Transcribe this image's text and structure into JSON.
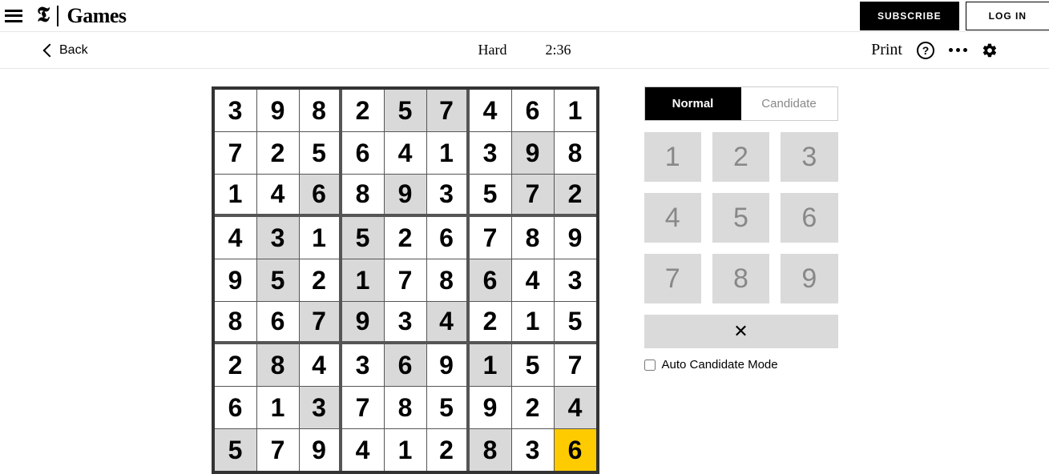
{
  "header": {
    "brand_t": "𝕿",
    "brand_text": "Games",
    "subscribe_label": "SUBSCRIBE",
    "login_label": "LOG IN"
  },
  "toolbar": {
    "back_label": "Back",
    "difficulty": "Hard",
    "timer": "2:36",
    "print_label": "Print"
  },
  "modes": {
    "normal": "Normal",
    "candidate": "Candidate"
  },
  "numpad": [
    "1",
    "2",
    "3",
    "4",
    "5",
    "6",
    "7",
    "8",
    "9"
  ],
  "erase_glyph": "✕",
  "auto_label": "Auto Candidate Mode",
  "board": [
    [
      {
        "v": "3",
        "p": false
      },
      {
        "v": "9",
        "p": false
      },
      {
        "v": "8",
        "p": false
      },
      {
        "v": "2",
        "p": false
      },
      {
        "v": "5",
        "p": true
      },
      {
        "v": "7",
        "p": true
      },
      {
        "v": "4",
        "p": false
      },
      {
        "v": "6",
        "p": false
      },
      {
        "v": "1",
        "p": false
      }
    ],
    [
      {
        "v": "7",
        "p": false
      },
      {
        "v": "2",
        "p": false
      },
      {
        "v": "5",
        "p": false
      },
      {
        "v": "6",
        "p": false
      },
      {
        "v": "4",
        "p": false
      },
      {
        "v": "1",
        "p": false
      },
      {
        "v": "3",
        "p": false
      },
      {
        "v": "9",
        "p": true
      },
      {
        "v": "8",
        "p": false
      }
    ],
    [
      {
        "v": "1",
        "p": false
      },
      {
        "v": "4",
        "p": false
      },
      {
        "v": "6",
        "p": true
      },
      {
        "v": "8",
        "p": false
      },
      {
        "v": "9",
        "p": true
      },
      {
        "v": "3",
        "p": false
      },
      {
        "v": "5",
        "p": false
      },
      {
        "v": "7",
        "p": true
      },
      {
        "v": "2",
        "p": true
      }
    ],
    [
      {
        "v": "4",
        "p": false
      },
      {
        "v": "3",
        "p": true
      },
      {
        "v": "1",
        "p": false
      },
      {
        "v": "5",
        "p": true
      },
      {
        "v": "2",
        "p": false
      },
      {
        "v": "6",
        "p": false
      },
      {
        "v": "7",
        "p": false
      },
      {
        "v": "8",
        "p": false
      },
      {
        "v": "9",
        "p": false
      }
    ],
    [
      {
        "v": "9",
        "p": false
      },
      {
        "v": "5",
        "p": true
      },
      {
        "v": "2",
        "p": false
      },
      {
        "v": "1",
        "p": true
      },
      {
        "v": "7",
        "p": false
      },
      {
        "v": "8",
        "p": false
      },
      {
        "v": "6",
        "p": true
      },
      {
        "v": "4",
        "p": false
      },
      {
        "v": "3",
        "p": false
      }
    ],
    [
      {
        "v": "8",
        "p": false
      },
      {
        "v": "6",
        "p": false
      },
      {
        "v": "7",
        "p": true
      },
      {
        "v": "9",
        "p": true
      },
      {
        "v": "3",
        "p": false
      },
      {
        "v": "4",
        "p": true
      },
      {
        "v": "2",
        "p": false
      },
      {
        "v": "1",
        "p": false
      },
      {
        "v": "5",
        "p": false
      }
    ],
    [
      {
        "v": "2",
        "p": false
      },
      {
        "v": "8",
        "p": true
      },
      {
        "v": "4",
        "p": false
      },
      {
        "v": "3",
        "p": false
      },
      {
        "v": "6",
        "p": true
      },
      {
        "v": "9",
        "p": false
      },
      {
        "v": "1",
        "p": true
      },
      {
        "v": "5",
        "p": false
      },
      {
        "v": "7",
        "p": false
      }
    ],
    [
      {
        "v": "6",
        "p": false
      },
      {
        "v": "1",
        "p": false
      },
      {
        "v": "3",
        "p": true
      },
      {
        "v": "7",
        "p": false
      },
      {
        "v": "8",
        "p": false
      },
      {
        "v": "5",
        "p": false
      },
      {
        "v": "9",
        "p": false
      },
      {
        "v": "2",
        "p": false
      },
      {
        "v": "4",
        "p": true
      }
    ],
    [
      {
        "v": "5",
        "p": true
      },
      {
        "v": "7",
        "p": false
      },
      {
        "v": "9",
        "p": false
      },
      {
        "v": "4",
        "p": false
      },
      {
        "v": "1",
        "p": false
      },
      {
        "v": "2",
        "p": false
      },
      {
        "v": "8",
        "p": true
      },
      {
        "v": "3",
        "p": false
      },
      {
        "v": "6",
        "p": false,
        "sel": true
      }
    ]
  ]
}
